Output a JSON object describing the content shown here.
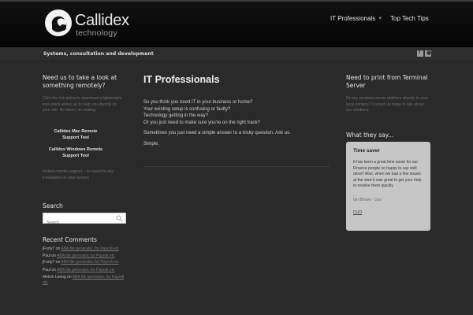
{
  "header": {
    "logo_name": "Callidex",
    "logo_sub": "technology",
    "nav": [
      {
        "label": "IT Professionals",
        "has_dropdown": true
      },
      {
        "label": "Top Tech Tips"
      }
    ]
  },
  "tagbar": {
    "tagline": "Systems, consultation and development",
    "social": [
      "facebook-icon",
      "rss-icon"
    ]
  },
  "left": {
    "heading": "Need us to take a look at something remotely?",
    "intro": "Click the link below to download a lightweight tool which allows us to help you directly on your site. No travel, no waiting.",
    "link_mac": "Callidex Mac Remote Support Tool",
    "link_win": "Callidex Windows Remote Support Tool",
    "outro": "Instant remote support – no need for any installation on your system",
    "search_heading": "Search",
    "search_placeholder": "Search",
    "recent_heading": "Recent Comments",
    "comments": [
      {
        "author": "jForty7",
        "on": "on",
        "link": "ABA file generator, for Payroll etc"
      },
      {
        "author": "Paul",
        "on": "on",
        "link": "ABA file generator, for Payroll etc"
      },
      {
        "author": "jForty7",
        "on": "on",
        "link": "ABA file generator, for Payroll etc"
      },
      {
        "author": "Paul",
        "on": "on",
        "link": "ABA file generator, for Payroll etc"
      },
      {
        "author": "Melvin Leong",
        "on": "on",
        "link": "ABA file generator, for Payroll etc"
      }
    ]
  },
  "main": {
    "title": "IT Professionals",
    "para1_lines": [
      "So you think you need IT in your business or home?",
      "Your existing setup is confusing or faulty?",
      "Technology getting in the way?",
      "Or you just need to make sure you're on the right track?"
    ],
    "para2": "Sometimes you just need a simple answer to a tricky question. Ask us.",
    "para3": "Simple."
  },
  "right": {
    "heading": "Need to print from Terminal Server",
    "desc": "Or any windows server platform directly to your local printers? Contact us today to talk about our solutions.",
    "say_heading": "What they say...",
    "testimonial": {
      "title": "Time saver",
      "body": "It has been a great time saver for our Finance people so happy to say well done!! Also, when we had a few issues at the start it was great to get your help to resolve them quickly",
      "dots": "...",
      "author": "Ian Brown - Duo",
      "link": "DUO"
    }
  }
}
